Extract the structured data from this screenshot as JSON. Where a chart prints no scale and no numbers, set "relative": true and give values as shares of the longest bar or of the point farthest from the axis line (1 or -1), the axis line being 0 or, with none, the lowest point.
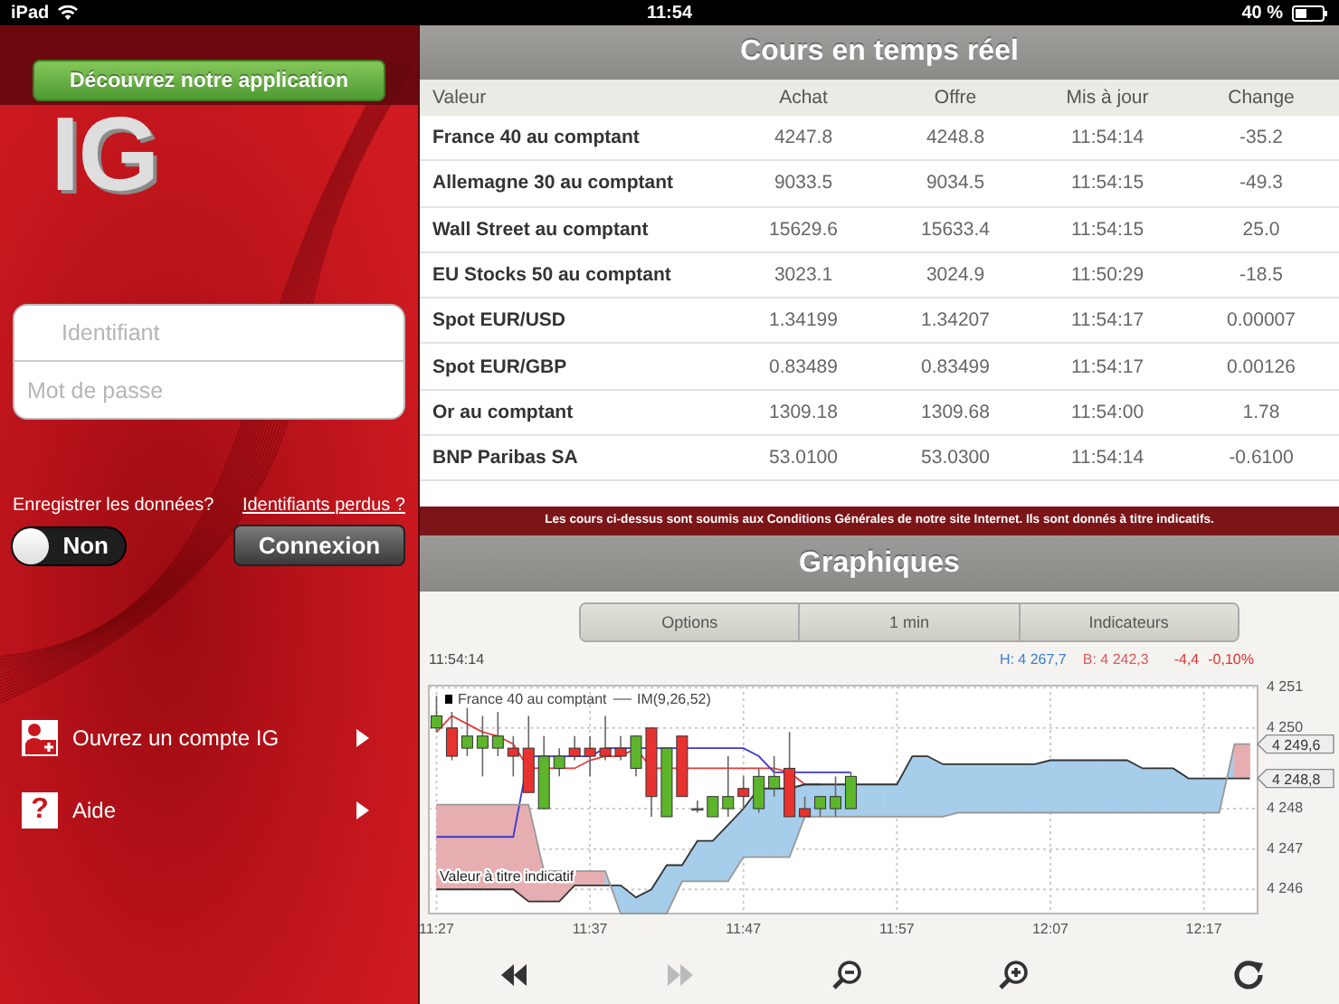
{
  "status_bar": {
    "device": "iPad",
    "time": "11:54",
    "battery": "40 %"
  },
  "sidebar": {
    "promo_button": "Découvrez notre application",
    "logo": "IG",
    "login_fields": [
      {
        "placeholder": "Identifiant"
      },
      {
        "placeholder": "Mot de passe"
      }
    ],
    "remember_label": "Enregistrer les données?",
    "forgot_link": "Identifiants perdus ?",
    "remember_switch": {
      "label": "Non",
      "on": false
    },
    "login_button": "Connexion",
    "menu": [
      {
        "label": "Ouvrez un compte IG",
        "kind": "account"
      },
      {
        "label": "Aide",
        "kind": "help",
        "glyph": "?"
      }
    ]
  },
  "quotes": {
    "title": "Cours en temps réel",
    "columns": [
      "Valeur",
      "Achat",
      "Offre",
      "Mis à jour",
      "Change"
    ],
    "rows": [
      [
        "France 40 au comptant",
        "4247.8",
        "4248.8",
        "11:54:14",
        "-35.2"
      ],
      [
        "Allemagne 30 au comptant",
        "9033.5",
        "9034.5",
        "11:54:15",
        "-49.3"
      ],
      [
        "Wall Street au comptant",
        "15629.6",
        "15633.4",
        "11:54:15",
        "25.0"
      ],
      [
        "EU Stocks 50 au comptant",
        "3023.1",
        "3024.9",
        "11:50:29",
        "-18.5"
      ],
      [
        "Spot EUR/USD",
        "1.34199",
        "1.34207",
        "11:54:17",
        "0.00007"
      ],
      [
        "Spot EUR/GBP",
        "0.83489",
        "0.83499",
        "11:54:17",
        "0.00126"
      ],
      [
        "Or au comptant",
        "1309.18",
        "1309.68",
        "11:54:00",
        "1.78"
      ],
      [
        "BNP Paribas SA",
        "53.0100",
        "53.0300",
        "11:54:14",
        "-0.6100"
      ]
    ],
    "disclaimer": "Les cours ci-dessus sont soumis aux Conditions Générales de notre site Internet. Ils sont donnés à titre indicatifs."
  },
  "charts": {
    "title": "Graphiques",
    "segments": [
      "Options",
      "1 min",
      "Indicateurs"
    ],
    "info": {
      "time": "11:54:14",
      "high": "H: 4 267,7",
      "low": "B: 4 242,3",
      "change": "-4,4",
      "change_pct": "-0,10%"
    },
    "legend": [
      "France 40 au comptant",
      "IM(9,26,52)"
    ],
    "note": "Valeur à titre indicatif",
    "chart_data": {
      "type": "candlestick",
      "grid": true,
      "ylim": [
        4245.4,
        4251.05
      ],
      "categories": [
        "11:27",
        null,
        null,
        null,
        null,
        null,
        null,
        null,
        null,
        null,
        "11:37",
        null,
        null,
        null,
        null,
        null,
        null,
        null,
        null,
        null,
        "11:47",
        null,
        null,
        null,
        null,
        null,
        null,
        null,
        null,
        null,
        "11:57",
        null,
        null,
        null,
        null,
        null,
        null,
        null,
        null,
        null,
        "12:07",
        null,
        null,
        null,
        null,
        null,
        null,
        null,
        null,
        null,
        "12:17",
        null,
        null,
        null
      ],
      "yticks": [
        {
          "value": 4251,
          "label": "4 251"
        },
        {
          "value": 4250,
          "label": "4 250"
        },
        {
          "value": 4248,
          "label": "4 248"
        },
        {
          "value": 4247,
          "label": "4 247"
        },
        {
          "value": 4246,
          "label": "4 246"
        }
      ],
      "ohlc": [
        [
          4250.0,
          4250.8,
          4249.9,
          4250.3
        ],
        [
          4250.0,
          4250.4,
          4249.2,
          4249.3
        ],
        [
          4249.5,
          4250.5,
          4249.3,
          4249.8
        ],
        [
          4249.5,
          4250.3,
          4248.8,
          4249.8
        ],
        [
          4249.5,
          4250.4,
          4249.3,
          4249.8
        ],
        [
          4249.5,
          4249.8,
          4248.8,
          4249.3
        ],
        [
          4249.5,
          4250.3,
          4248.4,
          4248.4
        ],
        [
          4248.0,
          4249.8,
          4248.0,
          4249.3
        ],
        [
          4249.0,
          4249.5,
          4248.8,
          4249.3
        ],
        [
          4249.5,
          4249.8,
          4249.2,
          4249.3
        ],
        [
          4249.5,
          4249.8,
          4248.8,
          4249.3
        ],
        [
          4249.5,
          4250.3,
          4249.2,
          4249.3
        ],
        [
          4249.5,
          4249.8,
          4249.2,
          4249.3
        ],
        [
          4249.0,
          4249.8,
          4248.8,
          4249.8
        ],
        [
          4250.0,
          4250.0,
          4247.8,
          4248.3
        ],
        [
          4247.8,
          4249.5,
          4247.8,
          4249.5
        ],
        [
          4249.8,
          4249.8,
          4248.3,
          4248.3
        ],
        [
          4248.0,
          4248.2,
          4247.9,
          4248.0
        ],
        [
          4247.8,
          4248.3,
          4247.8,
          4248.3
        ],
        [
          4248.0,
          4249.3,
          4247.8,
          4248.3
        ],
        [
          4248.5,
          4248.8,
          4248.0,
          4248.3
        ],
        [
          4248.0,
          4249.0,
          4247.9,
          4248.8
        ],
        [
          4248.5,
          4249.3,
          4248.3,
          4248.8
        ],
        [
          4249.0,
          4249.9,
          4247.8,
          4247.8
        ],
        [
          4248.0,
          4248.3,
          4247.8,
          4247.8
        ],
        [
          4248.0,
          4248.3,
          4247.8,
          4248.3
        ],
        [
          4248.0,
          4248.8,
          4247.8,
          4248.3
        ],
        [
          4248.0,
          4248.9,
          4248.0,
          4248.8
        ],
        null,
        null,
        null,
        null,
        null,
        null,
        null,
        null,
        null,
        null,
        null,
        null,
        null,
        null,
        null,
        null,
        null,
        null,
        null,
        null,
        null,
        null,
        null,
        null,
        null,
        null
      ],
      "annotations": [
        "4 249,6",
        "4 248,8"
      ]
    },
    "indicator": {
      "chart_data": {
        "type": "line",
        "relative": true,
        "ylim": [
          4245.4,
          4251.05
        ],
        "series": [
          {
            "color": "#e23a3a",
            "values": [
              4249.9,
              4250.3,
              4250.1,
              4249.9,
              4249.8,
              4249.6,
              4249.0,
              4249.0,
              4249.0,
              4249.0,
              4249.2,
              4249.3,
              4249.3,
              4249.5,
              4249.0,
              4249.0,
              4249.0,
              4249.0,
              4249.0,
              4249.0,
              4249.0,
              4249.0,
              4249.0,
              4248.9,
              4248.6,
              4248.6,
              null,
              null,
              null,
              null,
              null,
              null,
              null,
              null,
              null,
              null,
              null,
              null,
              null,
              null,
              null,
              null,
              null,
              null,
              null,
              null,
              null,
              null,
              null,
              null,
              null,
              null,
              null,
              null
            ]
          },
          {
            "color": "#3a3ad0",
            "values": [
              4247.3,
              4247.3,
              4247.3,
              4247.3,
              4247.3,
              4247.3,
              4249.3,
              4249.3,
              4249.3,
              4249.3,
              4249.3,
              4249.5,
              4249.5,
              4249.5,
              4249.5,
              4249.5,
              4249.5,
              4249.5,
              4249.5,
              4249.5,
              4249.5,
              4249.3,
              4248.9,
              4248.9,
              4248.9,
              4248.9,
              4248.9,
              4248.9,
              null,
              null,
              null,
              null,
              null,
              null,
              null,
              null,
              null,
              null,
              null,
              null,
              null,
              null,
              null,
              null,
              null,
              null,
              null,
              null,
              null,
              null,
              null,
              null,
              null,
              null
            ]
          },
          {
            "color": "#333333",
            "values": [
              4246.0,
              4246.0,
              4246.0,
              4246.0,
              4246.0,
              4246.0,
              4245.7,
              4245.7,
              4245.7,
              4246.1,
              4246.1,
              4246.1,
              4246.1,
              4245.8,
              4246.0,
              4246.6,
              4246.6,
              4247.2,
              4247.2,
              4247.6,
              4248.0,
              4248.5,
              4248.5,
              4248.5,
              4248.6,
              4248.6,
              4248.6,
              4248.6,
              4248.6,
              4248.6,
              4248.6,
              4249.3,
              4249.3,
              4249.1,
              4249.1,
              4249.1,
              4249.1,
              4249.1,
              4249.1,
              4249.1,
              4249.2,
              4249.2,
              4249.2,
              4249.2,
              4249.2,
              4249.2,
              4249.0,
              4249.0,
              4249.0,
              4248.75,
              4248.75,
              4248.75,
              4248.75,
              4248.75
            ]
          },
          {
            "color": "#999999",
            "values": [
              4248.1,
              4248.1,
              4248.1,
              4248.1,
              4248.1,
              4248.1,
              4248.1,
              4246.45,
              4246.45,
              4246.45,
              4246.45,
              4246.45,
              4245.4,
              4245.4,
              4245.4,
              4245.4,
              4246.2,
              4246.2,
              4246.2,
              4246.2,
              4246.8,
              4246.8,
              4246.8,
              4246.8,
              4247.8,
              4247.8,
              4247.8,
              4247.8,
              4247.8,
              4247.8,
              4247.8,
              4247.8,
              4247.8,
              4247.8,
              4247.9,
              4247.9,
              4247.9,
              4247.9,
              4247.9,
              4247.9,
              4247.9,
              4247.9,
              4247.9,
              4247.9,
              4247.9,
              4247.9,
              4247.9,
              4247.9,
              4247.9,
              4247.9,
              4247.9,
              4247.9,
              4249.6,
              4249.6
            ]
          }
        ]
      }
    },
    "controls": [
      {
        "kind": "rewind",
        "disabled": false
      },
      {
        "kind": "forward",
        "disabled": true
      },
      {
        "kind": "zoom_out",
        "disabled": false
      },
      {
        "kind": "zoom_in",
        "disabled": false
      },
      {
        "kind": "refresh",
        "disabled": false
      }
    ]
  }
}
